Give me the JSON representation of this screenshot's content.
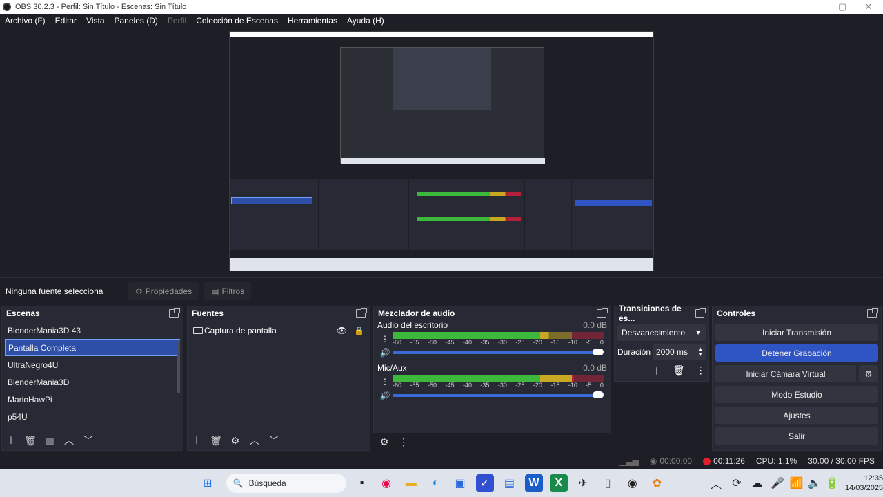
{
  "titlebar": {
    "title": "OBS 30.2.3 - Perfil: Sin Título - Escenas: Sin Título"
  },
  "menu": [
    {
      "label": "Archivo (F)",
      "dim": false
    },
    {
      "label": "Editar",
      "dim": false
    },
    {
      "label": "Vista",
      "dim": false
    },
    {
      "label": "Paneles (D)",
      "dim": false
    },
    {
      "label": "Perfil",
      "dim": true
    },
    {
      "label": "Colección de Escenas",
      "dim": false
    },
    {
      "label": "Herramientas",
      "dim": false
    },
    {
      "label": "Ayuda (H)",
      "dim": false
    }
  ],
  "source_bar": {
    "no_source": "Ninguna fuente selecciona",
    "properties": "Propiedades",
    "filters": "Filtros"
  },
  "scenes": {
    "title": "Escenas",
    "items": [
      "BlenderMania3D 43",
      "Pantalla Completa",
      "UltraNegro4U",
      "BlenderMania3D",
      "MarioHawPi",
      "p54U"
    ],
    "selected_index": 1
  },
  "sources": {
    "title": "Fuentes",
    "items": [
      {
        "label": "Captura de pantalla"
      }
    ]
  },
  "mixer": {
    "title": "Mezclador de audio",
    "channels": [
      {
        "name": "Audio del escritorio",
        "db": "0.0 dB",
        "level": 0.74,
        "volume": 1.0
      },
      {
        "name": "Mic/Aux",
        "db": "0.0 dB",
        "level": 0.86,
        "volume": 1.0
      }
    ],
    "scale": [
      "-60",
      "-55",
      "-50",
      "-45",
      "-40",
      "-35",
      "-30",
      "-25",
      "-20",
      "-15",
      "-10",
      "-5",
      "0"
    ]
  },
  "transitions": {
    "title": "Transiciones de es...",
    "selected": "Desvanecimiento",
    "duration_label": "Duración",
    "duration_value": "2000 ms"
  },
  "controls": {
    "title": "Controles",
    "start_stream": "Iniciar Transmisión",
    "stop_recording": "Detener Grabación",
    "start_virtual_cam": "Iniciar Cámara Virtual",
    "studio_mode": "Modo Estudio",
    "settings": "Ajustes",
    "exit": "Salir"
  },
  "status": {
    "stream_time": "00:00:00",
    "rec_time": "00:11:26",
    "cpu": "CPU: 1.1%",
    "fps": "30.00 / 30.00 FPS"
  },
  "taskbar": {
    "search": "Búsqueda",
    "time": "12:35",
    "date": "14/03/2025"
  },
  "colors": {
    "accent": "#2f55c4",
    "rec": "#e0202a",
    "meter_green": "#3db83d",
    "meter_yellow": "#c8a823",
    "meter_red": "#b32139"
  }
}
